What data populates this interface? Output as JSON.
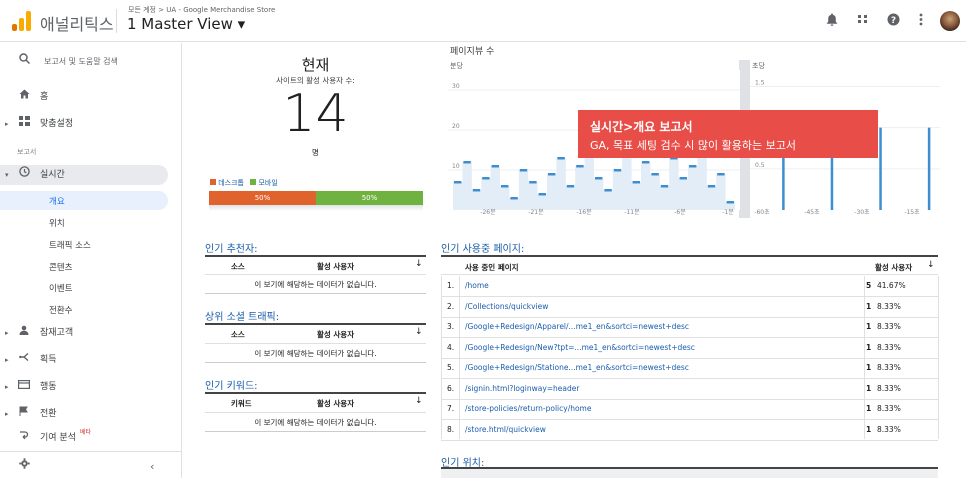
{
  "header": {
    "app_name": "애널리틱스",
    "breadcrumb": "모든 계정 > UA - Google Merchandise Store",
    "view_name": "1 Master View ▾",
    "icons": [
      "bell-icon",
      "apps-icon",
      "help-icon",
      "more-icon"
    ]
  },
  "sidebar": {
    "search_placeholder": "보고서 및 도움말 검색",
    "home": "홈",
    "custom": "맞춤설정",
    "section_reports": "보고서",
    "realtime": "실시간",
    "realtime_items": [
      "개요",
      "위치",
      "트래픽 소스",
      "콘텐츠",
      "이벤트",
      "전환수"
    ],
    "audience": "잠재고객",
    "acquisition": "획득",
    "behavior": "행동",
    "conversions": "전환",
    "attribution": "기여 분석",
    "beta_label": "베타"
  },
  "now": {
    "title": "현재",
    "subtitle": "사이트의 활성 사용자 수:",
    "count": "14",
    "unit": "명",
    "legend_desktop": "데스크톱",
    "legend_mobile": "모바일",
    "desktop_pct": "50%",
    "mobile_pct": "50%",
    "desktop_share": 0.5,
    "colors": {
      "desktop": "#e0622d",
      "mobile": "#6fb23f"
    }
  },
  "pageviews": {
    "title": "페이지뷰 수",
    "per_minute": "분당",
    "per_second": "초당",
    "y_ticks_min": [
      "30",
      "20",
      "10"
    ],
    "y_ticks_sec": [
      "1.5",
      "1",
      "0.5"
    ],
    "x_ticks_min": [
      "-26분",
      "-21분",
      "-16분",
      "-11분",
      "-6분",
      "-1분"
    ],
    "x_ticks_sec": [
      "-60초",
      "-45초",
      "-30초",
      "-15초"
    ]
  },
  "chart_data": [
    {
      "type": "bar",
      "title": "분당",
      "y_ticks": [
        "30",
        "20",
        "10"
      ],
      "ylim": [
        0,
        35
      ],
      "x_ticks": [
        "-26분",
        "-21분",
        "-16분",
        "-11분",
        "-6분",
        "-1분"
      ],
      "values": [
        7,
        12,
        5,
        8,
        11,
        6,
        3,
        10,
        7,
        4,
        9,
        13,
        6,
        11,
        14,
        8,
        5,
        10,
        15,
        7,
        12,
        9,
        6,
        13,
        8,
        11,
        14,
        6,
        9,
        2
      ]
    },
    {
      "type": "bar",
      "title": "초당",
      "y_ticks": [
        "1.5",
        "1",
        "0.5"
      ],
      "ylim": [
        0,
        1.7
      ],
      "x_ticks": [
        "-60초",
        "-45초",
        "-30초",
        "-15초"
      ],
      "values": [
        0,
        1,
        0,
        0,
        0,
        1,
        0,
        0,
        0,
        1,
        0,
        0,
        0,
        1
      ]
    }
  ],
  "overlay": {
    "title": "실시간>개요 보고서",
    "text": "GA, 목표 세팅 검수 시 많이 활용하는 보고서"
  },
  "referrers": {
    "title": "인기 추천자:",
    "col1": "소스",
    "col2": "활성 사용자",
    "empty": "이 보기에 해당하는 데이터가 없습니다."
  },
  "social": {
    "title": "상위 소셜 트래픽:",
    "col1": "소스",
    "col2": "활성 사용자",
    "empty": "이 보기에 해당하는 데이터가 없습니다."
  },
  "keywords": {
    "title": "인기 키워드:",
    "col1": "키워드",
    "col2": "활성 사용자",
    "empty": "이 보기에 해당하는 데이터가 없습니다."
  },
  "active_pages": {
    "title": "인기 사용중 페이지:",
    "col1": "사용 중인 페이지",
    "col2": "활성 사용자",
    "rows": [
      {
        "n": "1.",
        "url": "/home",
        "v": "5",
        "p": "41.67%"
      },
      {
        "n": "2.",
        "url": "/Collections/quickview",
        "v": "1",
        "p": "8.33%"
      },
      {
        "n": "3.",
        "url": "/Google+Redesign/Apparel/...me1_en&sortci=newest+desc",
        "v": "1",
        "p": "8.33%"
      },
      {
        "n": "4.",
        "url": "/Google+Redesign/New?tpt=...me1_en&sortci=newest+desc",
        "v": "1",
        "p": "8.33%"
      },
      {
        "n": "5.",
        "url": "/Google+Redesign/Statione...me1_en&sortci=newest+desc",
        "v": "1",
        "p": "8.33%"
      },
      {
        "n": "6.",
        "url": "/signin.html?loginway=header",
        "v": "1",
        "p": "8.33%"
      },
      {
        "n": "7.",
        "url": "/store-policies/return-policy/home",
        "v": "1",
        "p": "8.33%"
      },
      {
        "n": "8.",
        "url": "/store.html/quickview",
        "v": "1",
        "p": "8.33%"
      }
    ]
  },
  "locations": {
    "title": "인기 위치:"
  }
}
